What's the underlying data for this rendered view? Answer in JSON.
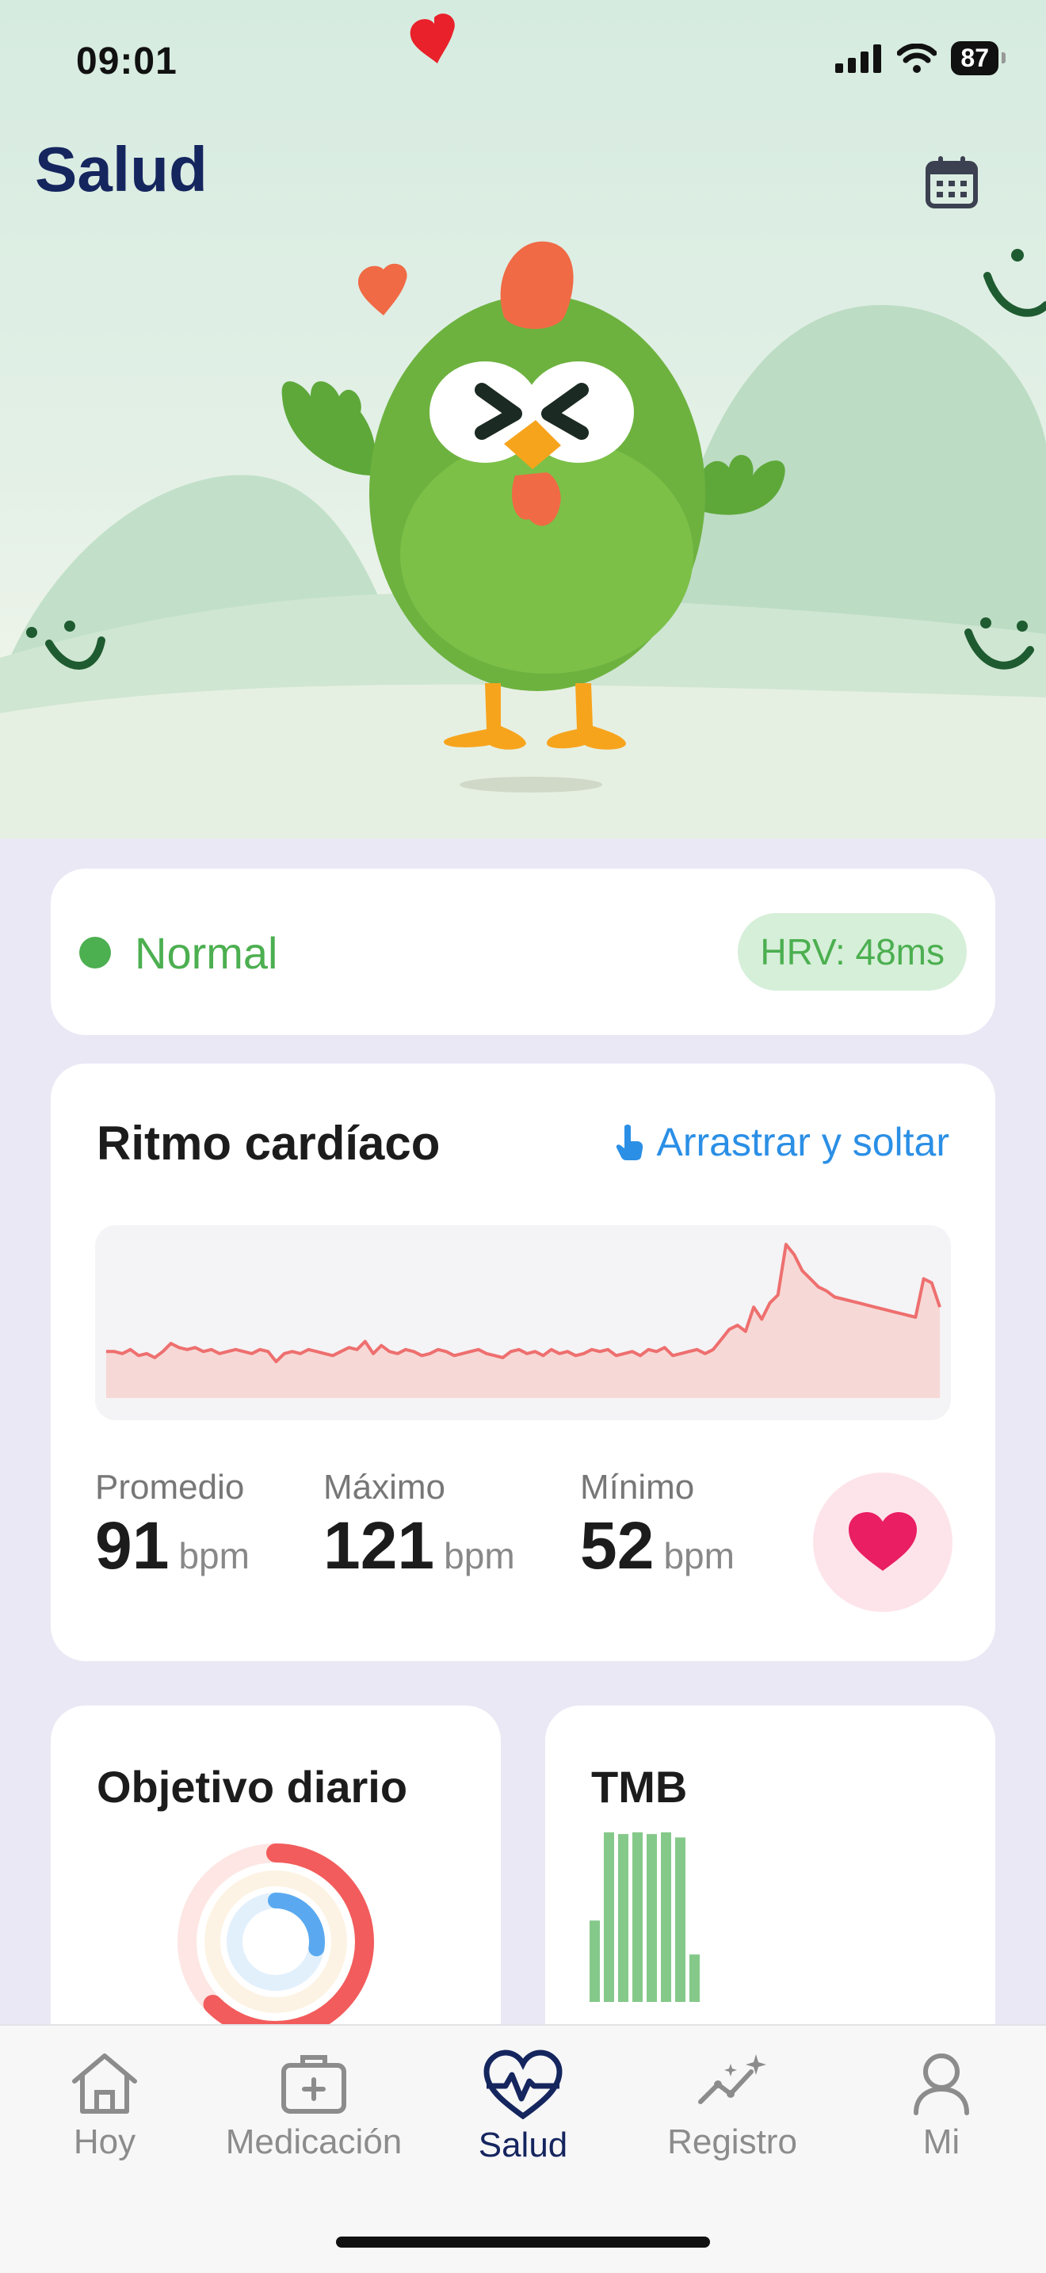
{
  "status_bar": {
    "time": "09:01",
    "battery": "87"
  },
  "header": {
    "title": "Salud"
  },
  "status_card": {
    "label": "Normal",
    "hrv": "HRV: 48ms"
  },
  "heart_rate": {
    "title": "Ritmo cardíaco",
    "drag_label": "Arrastrar y soltar",
    "stats": [
      {
        "label": "Promedio",
        "value": "91",
        "unit": "bpm"
      },
      {
        "label": "Máximo",
        "value": "121",
        "unit": "bpm"
      },
      {
        "label": "Mínimo",
        "value": "52",
        "unit": "bpm"
      }
    ]
  },
  "chart_data": {
    "type": "area",
    "color": "#ee6f6f",
    "values": [
      68,
      68,
      67,
      69,
      66,
      67,
      65,
      68,
      72,
      70,
      69,
      70,
      68,
      69,
      67,
      68,
      69,
      68,
      67,
      69,
      68,
      63,
      67,
      68,
      67,
      69,
      68,
      67,
      66,
      68,
      70,
      69,
      73,
      67,
      71,
      68,
      67,
      69,
      68,
      66,
      67,
      69,
      68,
      66,
      67,
      68,
      69,
      67,
      66,
      65,
      68,
      69,
      67,
      68,
      66,
      69,
      67,
      68,
      66,
      67,
      69,
      68,
      69,
      66,
      67,
      68,
      66,
      69,
      68,
      70,
      66,
      67,
      68,
      69,
      67,
      69,
      74,
      79,
      81,
      78,
      90,
      84,
      92,
      96,
      121,
      116,
      108,
      104,
      100,
      98,
      95,
      94,
      93,
      92,
      91,
      90,
      89,
      88,
      87,
      86,
      85,
      104,
      102,
      90
    ]
  },
  "goal_card": {
    "title": "Objetivo diario"
  },
  "tmb_card": {
    "title": "TMB",
    "bars": [
      0.48,
      1.0,
      0.99,
      1.0,
      0.99,
      1.0,
      0.97,
      0.28
    ],
    "bar_color": "#85c98a"
  },
  "tabs": [
    {
      "label": "Hoy",
      "icon": "home-icon"
    },
    {
      "label": "Medicación",
      "icon": "medical-kit-icon"
    },
    {
      "label": "Salud",
      "icon": "heart-pulse-icon",
      "active": true
    },
    {
      "label": "Registro",
      "icon": "trend-sparkle-icon"
    },
    {
      "label": "Mi",
      "icon": "person-icon"
    }
  ]
}
